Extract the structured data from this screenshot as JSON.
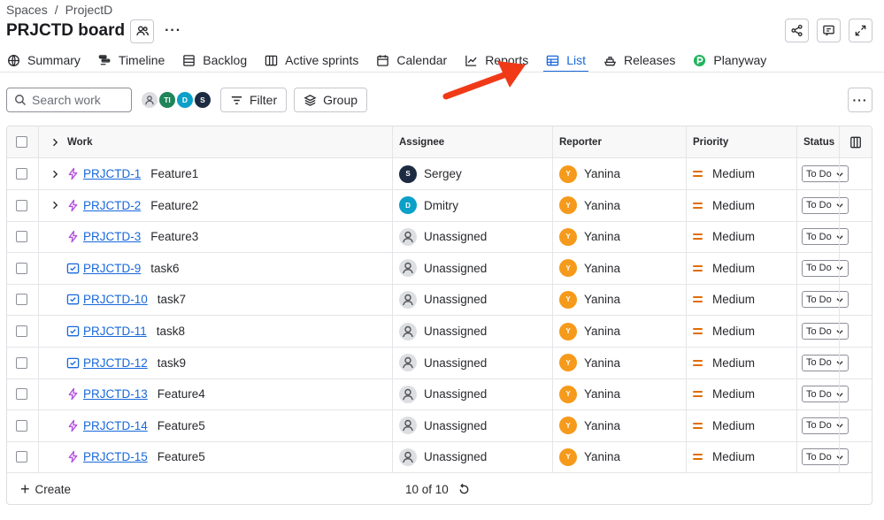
{
  "breadcrumb": {
    "spaces": "Spaces",
    "sep": "/",
    "project": "ProjectD"
  },
  "board_title": "PRJCTD board",
  "tabs": [
    {
      "label": "Summary",
      "icon": "globe-icon"
    },
    {
      "label": "Timeline",
      "icon": "timeline-icon"
    },
    {
      "label": "Backlog",
      "icon": "backlog-icon"
    },
    {
      "label": "Active sprints",
      "icon": "columns-icon"
    },
    {
      "label": "Calendar",
      "icon": "calendar-icon"
    },
    {
      "label": "Reports",
      "icon": "chart-line-icon"
    },
    {
      "label": "List",
      "icon": "list-table-icon",
      "active": true
    },
    {
      "label": "Releases",
      "icon": "ship-icon"
    },
    {
      "label": "Planyway",
      "icon": "planyway-icon"
    }
  ],
  "toolbar": {
    "search_placeholder": "Search work",
    "filter_label": "Filter",
    "group_label": "Group",
    "avatars": [
      {
        "initials": "",
        "color": "#c6c8cd"
      },
      {
        "initials": "TI",
        "color": "#1f845a"
      },
      {
        "initials": "D",
        "color": "#0aa0c8"
      },
      {
        "initials": "S",
        "color": "#1c2b42"
      }
    ]
  },
  "table": {
    "headers": {
      "work": "Work",
      "assignee": "Assignee",
      "reporter": "Reporter",
      "priority": "Priority",
      "status": "Status"
    },
    "rows": [
      {
        "key": "PRJCTD-1",
        "summary": "Feature1",
        "type": "feature",
        "expandable": true,
        "assignee": "Sergey",
        "assignee_initial": "S",
        "assignee_color": "#1c2b42",
        "reporter": "Yanina",
        "reporter_initial": "Y",
        "priority": "Medium",
        "status": "To Do"
      },
      {
        "key": "PRJCTD-2",
        "summary": "Feature2",
        "type": "feature",
        "expandable": true,
        "assignee": "Dmitry",
        "assignee_initial": "D",
        "assignee_color": "#0aa0c8",
        "reporter": "Yanina",
        "reporter_initial": "Y",
        "priority": "Medium",
        "status": "To Do"
      },
      {
        "key": "PRJCTD-3",
        "summary": "Feature3",
        "type": "feature",
        "expandable": false,
        "assignee": "Unassigned",
        "assignee_initial": "",
        "assignee_color": "",
        "reporter": "Yanina",
        "reporter_initial": "Y",
        "priority": "Medium",
        "status": "To Do"
      },
      {
        "key": "PRJCTD-9",
        "summary": "task6",
        "type": "task",
        "expandable": false,
        "assignee": "Unassigned",
        "assignee_initial": "",
        "assignee_color": "",
        "reporter": "Yanina",
        "reporter_initial": "Y",
        "priority": "Medium",
        "status": "To Do"
      },
      {
        "key": "PRJCTD-10",
        "summary": "task7",
        "type": "task",
        "expandable": false,
        "assignee": "Unassigned",
        "assignee_initial": "",
        "assignee_color": "",
        "reporter": "Yanina",
        "reporter_initial": "Y",
        "priority": "Medium",
        "status": "To Do"
      },
      {
        "key": "PRJCTD-11",
        "summary": "task8",
        "type": "task",
        "expandable": false,
        "assignee": "Unassigned",
        "assignee_initial": "",
        "assignee_color": "",
        "reporter": "Yanina",
        "reporter_initial": "Y",
        "priority": "Medium",
        "status": "To Do"
      },
      {
        "key": "PRJCTD-12",
        "summary": "task9",
        "type": "task",
        "expandable": false,
        "assignee": "Unassigned",
        "assignee_initial": "",
        "assignee_color": "",
        "reporter": "Yanina",
        "reporter_initial": "Y",
        "priority": "Medium",
        "status": "To Do"
      },
      {
        "key": "PRJCTD-13",
        "summary": "Feature4",
        "type": "feature",
        "expandable": false,
        "assignee": "Unassigned",
        "assignee_initial": "",
        "assignee_color": "",
        "reporter": "Yanina",
        "reporter_initial": "Y",
        "priority": "Medium",
        "status": "To Do"
      },
      {
        "key": "PRJCTD-14",
        "summary": "Feature5",
        "type": "feature",
        "expandable": false,
        "assignee": "Unassigned",
        "assignee_initial": "",
        "assignee_color": "",
        "reporter": "Yanina",
        "reporter_initial": "Y",
        "priority": "Medium",
        "status": "To Do"
      },
      {
        "key": "PRJCTD-15",
        "summary": "Feature5",
        "type": "feature",
        "expandable": false,
        "assignee": "Unassigned",
        "assignee_initial": "",
        "assignee_color": "",
        "reporter": "Yanina",
        "reporter_initial": "Y",
        "priority": "Medium",
        "status": "To Do"
      }
    ]
  },
  "footer": {
    "create_label": "Create",
    "count": "10 of 10"
  },
  "colors": {
    "accent": "#1868db",
    "reporter_avatar": "#f59a1b",
    "priority_medium": "#e06c00",
    "feature_icon": "#b34fe0",
    "task_icon": "#1868db",
    "annotation_arrow": "#f03a17"
  }
}
